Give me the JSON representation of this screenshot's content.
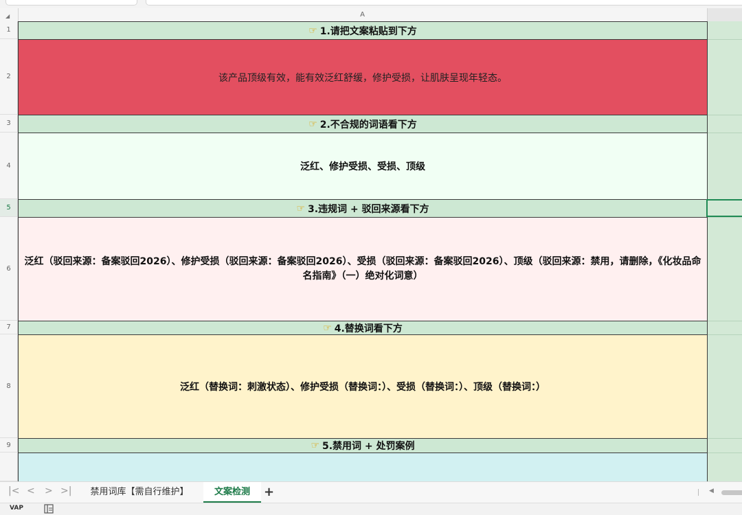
{
  "sheet": {
    "column_a_label": "A",
    "rows": [
      {
        "num": "1",
        "text": "1.请把文案粘贴到下方",
        "icon": "pointing-hand-icon"
      },
      {
        "num": "2",
        "text": "该产品顶级有效，能有效泛红舒缓，修护受损，让肌肤呈现年轻态。"
      },
      {
        "num": "3",
        "text": "2.不合规的词语看下方",
        "icon": "pointing-hand-icon"
      },
      {
        "num": "4",
        "text": "泛红、修护受损、受损、顶级"
      },
      {
        "num": "5",
        "text": "3.违规词 + 驳回来源看下方",
        "icon": "pointing-hand-icon"
      },
      {
        "num": "6",
        "text": "泛红（驳回来源：备案驳回2026）、修护受损（驳回来源：备案驳回2026）、受损（驳回来源：备案驳回2026）、顶级（驳回来源：禁用，请删除，《化妆品命名指南》（一）绝对化词意）"
      },
      {
        "num": "7",
        "text": "4.替换词看下方",
        "icon": "pointing-hand-icon"
      },
      {
        "num": "8",
        "text": "泛红（替换词：刺激状态）、修护受损（替换词：）、受损（替换词：）、顶级（替换词：）"
      },
      {
        "num": "9",
        "text": "5.禁用词 + 处罚案例",
        "icon": "pointing-hand-icon"
      }
    ],
    "colors": {
      "header_fill": "#cde8d3",
      "input_fill": "#e34f60",
      "noncompliant_fill": "#f1fff4",
      "violation_fill": "#fff0f0",
      "replacement_fill": "#fff3cb",
      "banned_fill": "#d2f1f2",
      "accent": "#1c7a48"
    }
  },
  "tabs": {
    "nav": [
      "|<",
      "<",
      ">",
      ">|"
    ],
    "items": [
      {
        "label": "禁用词库【需自行维护】",
        "active": false
      },
      {
        "label": "文案检测",
        "active": true
      }
    ],
    "add": "+"
  },
  "statusbar": {
    "left_label": "VAP"
  }
}
